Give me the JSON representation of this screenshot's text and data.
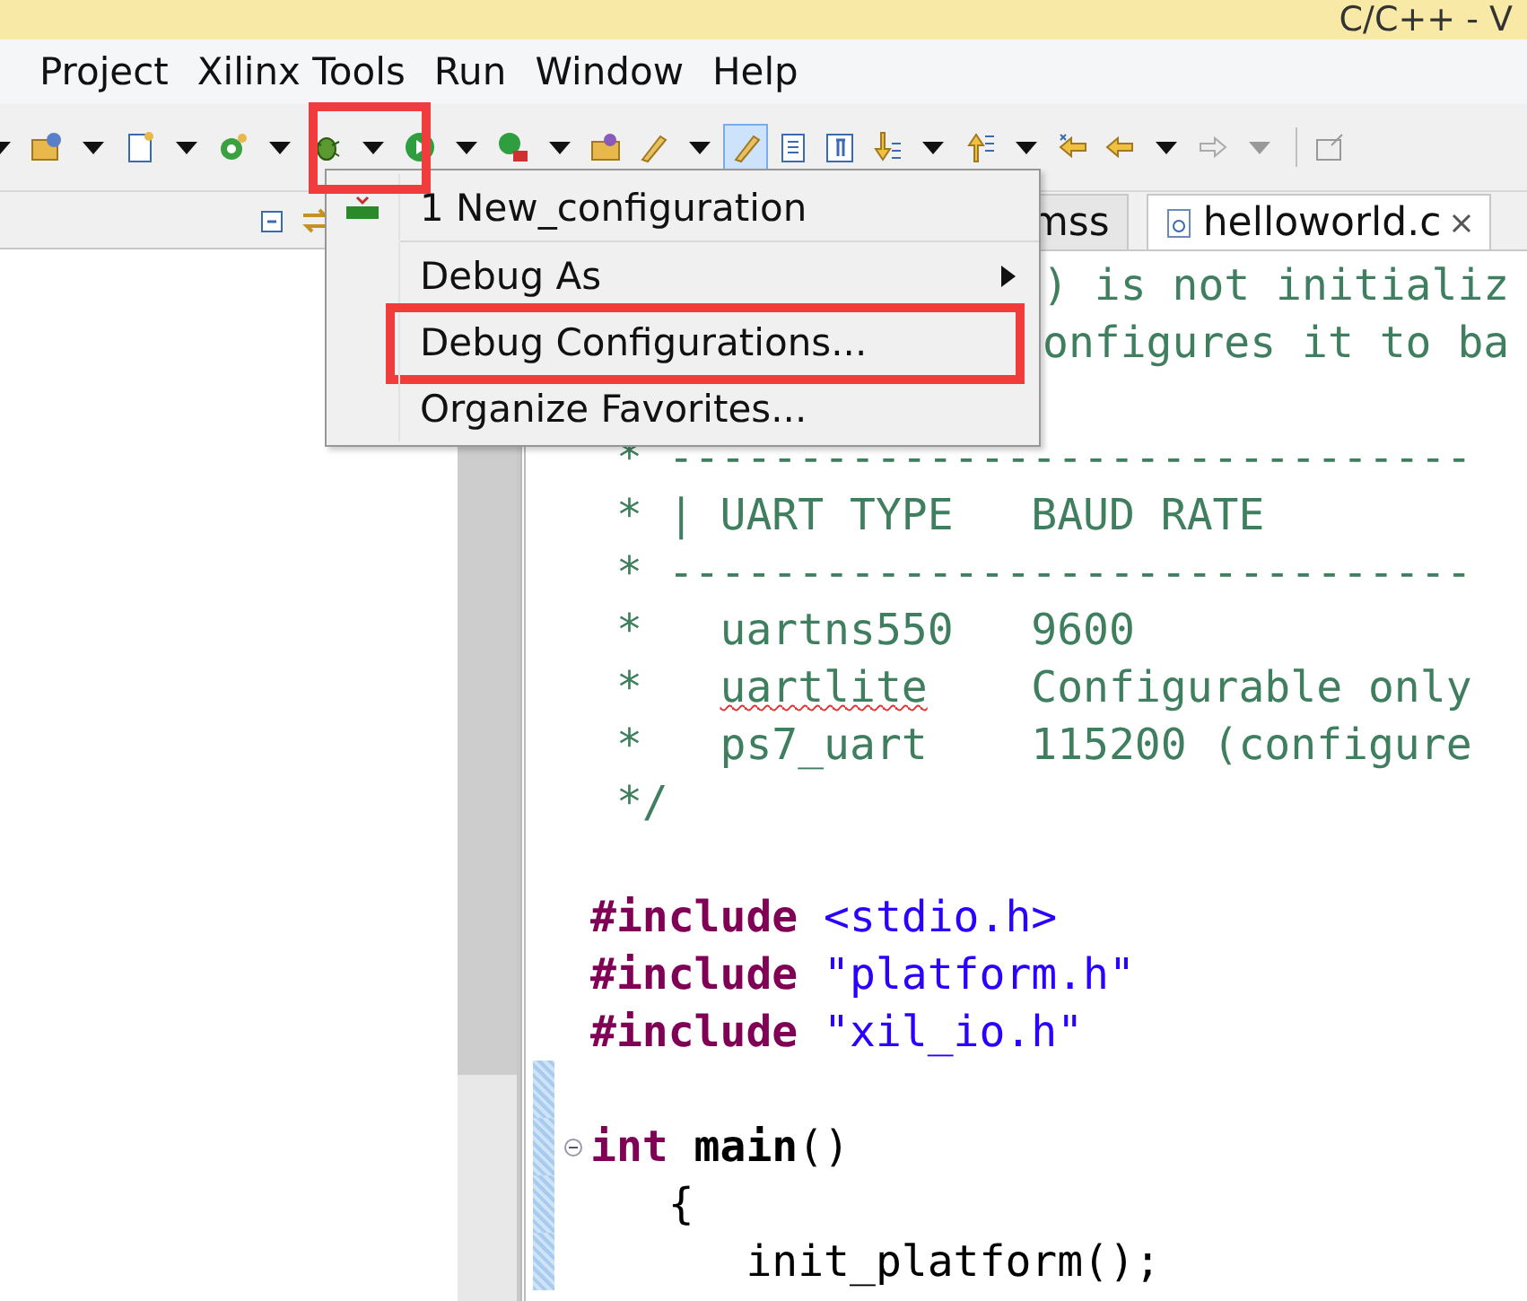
{
  "window": {
    "title": "C/C++ - V"
  },
  "menu_bar": [
    "Project",
    "Xilinx Tools",
    "Run",
    "Window",
    "Help"
  ],
  "toolbar": [
    {
      "kind": "caret"
    },
    {
      "kind": "folder-gear"
    },
    {
      "kind": "caret"
    },
    {
      "kind": "file"
    },
    {
      "kind": "caret"
    },
    {
      "kind": "refresh"
    },
    {
      "kind": "caret"
    },
    {
      "kind": "bug"
    },
    {
      "kind": "caret"
    },
    {
      "kind": "play"
    },
    {
      "kind": "caret"
    },
    {
      "kind": "play-box"
    },
    {
      "kind": "caret"
    },
    {
      "kind": "folder"
    },
    {
      "kind": "brush"
    },
    {
      "kind": "caret"
    },
    {
      "kind": "brush",
      "selected": true
    },
    {
      "kind": "document"
    },
    {
      "kind": "pilcrow"
    },
    {
      "kind": "down"
    },
    {
      "kind": "caret"
    },
    {
      "kind": "up"
    },
    {
      "kind": "caret"
    },
    {
      "kind": "left-star"
    },
    {
      "kind": "left"
    },
    {
      "kind": "caret"
    },
    {
      "kind": "right",
      "disabled": true
    },
    {
      "kind": "caret",
      "disabled": true
    },
    {
      "kind": "separator"
    },
    {
      "kind": "pin",
      "disabled": true
    }
  ],
  "editor_tabs": [
    {
      "label": "mss",
      "selected": false
    },
    {
      "label": "helloworld.c",
      "selected": true
    }
  ],
  "code_lines": [
    {
      "partial": true,
      "tokens": [
        {
          "kind": "comment",
          "text": ") is not initializ"
        }
      ]
    },
    {
      "partial": true,
      "tokens": [
        {
          "kind": "comment",
          "text": "onfigures it to ba"
        }
      ]
    },
    {
      "kind": "blank"
    },
    {
      "tokens": [
        {
          "kind": "comment",
          "text": " * -------------------------------"
        }
      ]
    },
    {
      "tokens": [
        {
          "kind": "comment",
          "text": " * | UART TYPE   BAUD RATE"
        }
      ]
    },
    {
      "tokens": [
        {
          "kind": "comment",
          "text": " * -------------------------------"
        }
      ]
    },
    {
      "tokens": [
        {
          "kind": "comment",
          "text": " *   uartns550   9600"
        }
      ]
    },
    {
      "tokens": [
        {
          "kind": "comment",
          "text": " *   "
        },
        {
          "kind": "comment",
          "text": "uartlite",
          "misspelled": true
        },
        {
          "kind": "comment",
          "text": "    Configurable only"
        }
      ]
    },
    {
      "tokens": [
        {
          "kind": "comment",
          "text": " *   ps7_uart    115200 (configure"
        }
      ]
    },
    {
      "tokens": [
        {
          "kind": "comment",
          "text": " */"
        }
      ]
    },
    {
      "kind": "blank"
    },
    {
      "tokens": [
        {
          "kind": "keyword",
          "text": "#include"
        },
        {
          "kind": "string",
          "text": " <stdio.h>"
        }
      ]
    },
    {
      "tokens": [
        {
          "kind": "keyword",
          "text": "#include"
        },
        {
          "kind": "string",
          "text": " \"platform.h\""
        }
      ]
    },
    {
      "tokens": [
        {
          "kind": "keyword",
          "text": "#include"
        },
        {
          "kind": "string",
          "text": " \"xil_io.h\""
        }
      ]
    },
    {
      "kind": "blank",
      "marker": true
    },
    {
      "marker": true,
      "foldable": true,
      "tokens": [
        {
          "kind": "keyword",
          "text": "int"
        },
        {
          "kind": "function",
          "text": " main"
        },
        {
          "kind": "plain",
          "text": "()"
        }
      ]
    },
    {
      "marker": true,
      "tokens": [
        {
          "kind": "plain",
          "text": "   {"
        }
      ]
    },
    {
      "marker": true,
      "tokens": [
        {
          "kind": "plain",
          "text": "      init_platform();"
        }
      ]
    }
  ],
  "context_menu": [
    {
      "kind": "item",
      "label": "1 New_configuration",
      "icon": true
    },
    {
      "kind": "separator"
    },
    {
      "kind": "submenu",
      "label": "Debug As"
    },
    {
      "kind": "item",
      "label": "Debug Configurations...",
      "highlighted": true
    },
    {
      "kind": "item",
      "label": "Organize Favorites..."
    }
  ]
}
